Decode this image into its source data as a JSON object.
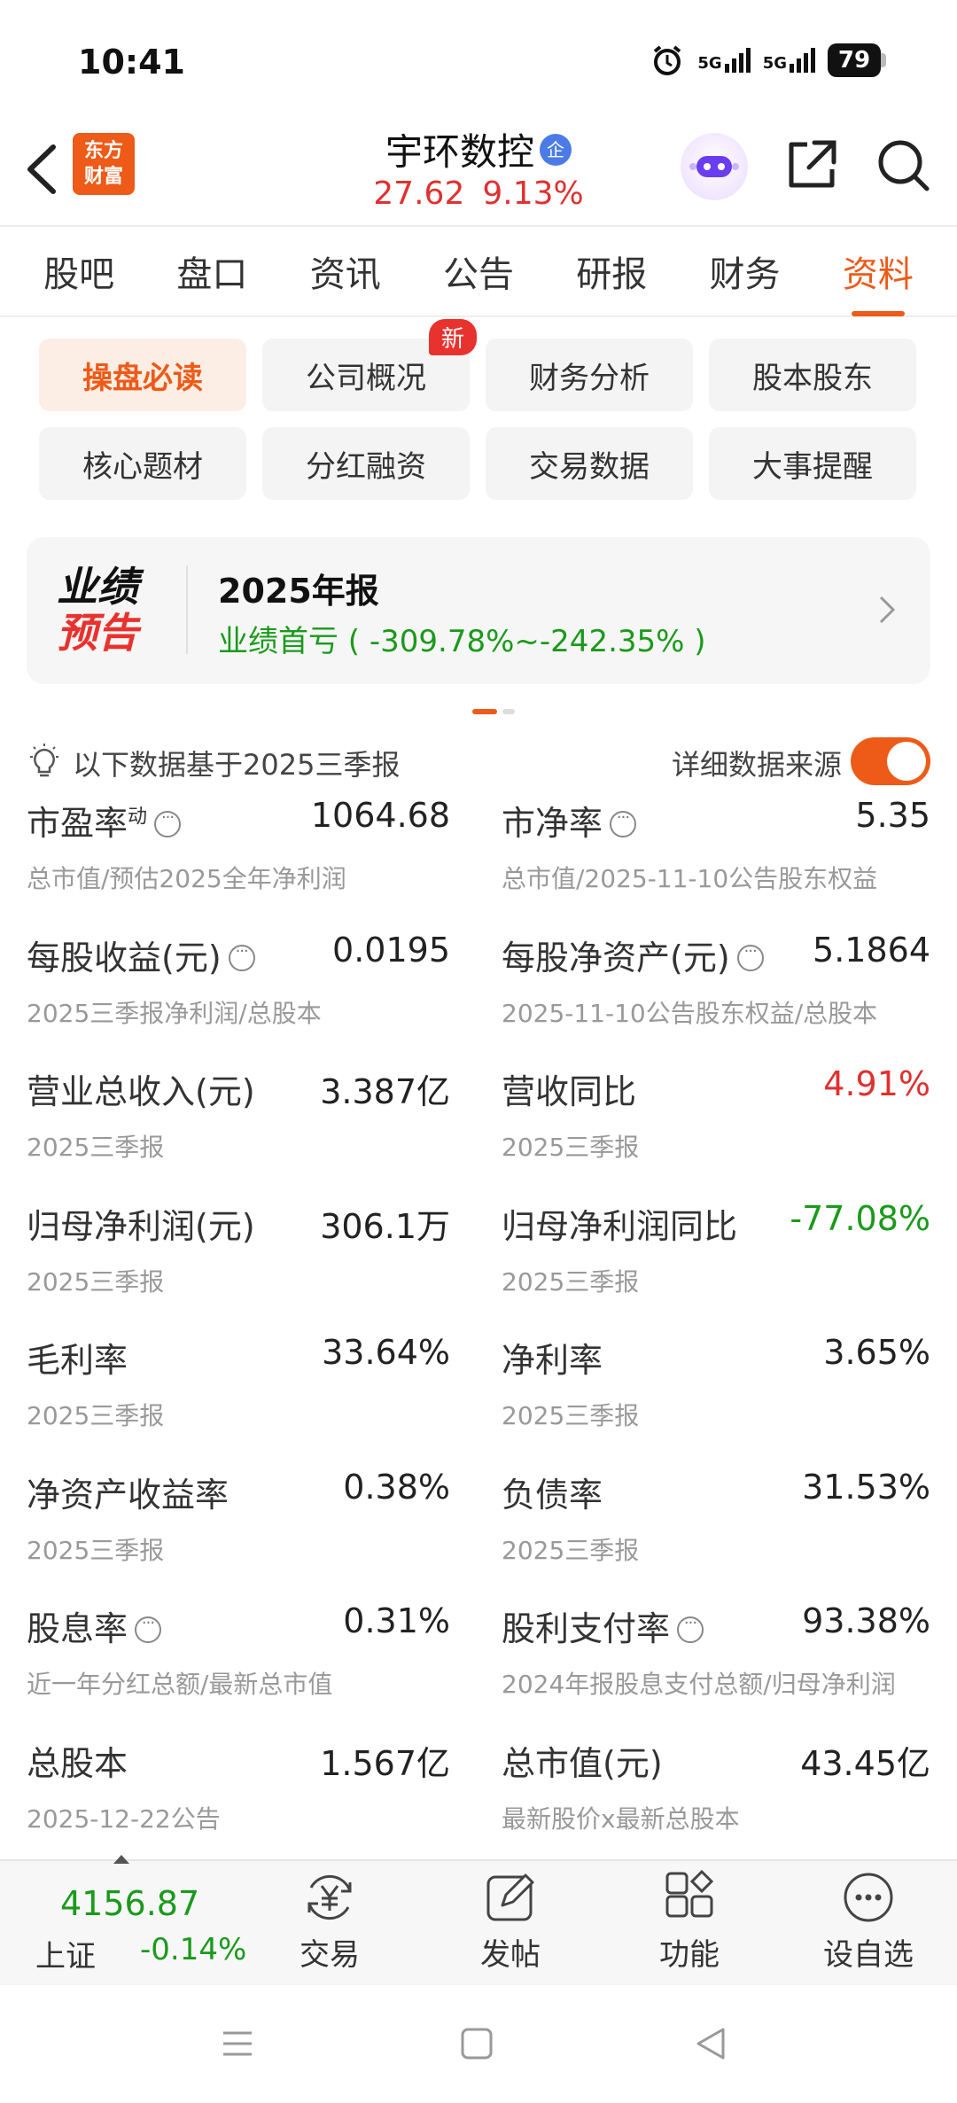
{
  "status_bar": {
    "time": "10:41",
    "net1": "5G",
    "net2": "5G",
    "battery": "79"
  },
  "header": {
    "logo_line1": "东方",
    "logo_line2": "财富",
    "stock_name": "宇环数控",
    "badge": "企",
    "price": "27.62",
    "change_pct": "9.13%"
  },
  "tabs": [
    {
      "label": "股吧"
    },
    {
      "label": "盘口"
    },
    {
      "label": "资讯"
    },
    {
      "label": "公告"
    },
    {
      "label": "研报"
    },
    {
      "label": "财务"
    },
    {
      "label": "资料",
      "active": true
    }
  ],
  "chips": [
    {
      "label": "操盘必读",
      "active": true
    },
    {
      "label": "公司概况",
      "badge": "新"
    },
    {
      "label": "财务分析"
    },
    {
      "label": "股本股东"
    },
    {
      "label": "核心题材"
    },
    {
      "label": "分红融资"
    },
    {
      "label": "交易数据"
    },
    {
      "label": "大事提醒"
    }
  ],
  "forecast": {
    "logo_line1": "业绩",
    "logo_line2": "预告",
    "title": "2025年报",
    "text": "业绩首亏 ( -309.78%~-242.35% )"
  },
  "basis": {
    "text": "以下数据基于2025三季报",
    "source_label": "详细数据来源",
    "source_on": true
  },
  "metrics": [
    {
      "name": "市盈率",
      "sup": "动",
      "info": true,
      "value": "1064.68",
      "sub": "总市值/预估2025全年净利润"
    },
    {
      "name": "市净率",
      "info": true,
      "value": "5.35",
      "sub": "总市值/2025-11-10公告股东权益"
    },
    {
      "name": "每股收益(元)",
      "info": true,
      "value": "0.0195",
      "sub": "2025三季报净利润/总股本"
    },
    {
      "name": "每股净资产(元)",
      "info": true,
      "value": "5.1864",
      "sub": "2025-11-10公告股东权益/总股本"
    },
    {
      "name": "营业总收入(元)",
      "value": "3.387亿",
      "sub": "2025三季报"
    },
    {
      "name": "营收同比",
      "value": "4.91%",
      "color": "red",
      "sub": "2025三季报"
    },
    {
      "name": "归母净利润(元)",
      "value": "306.1万",
      "sub": "2025三季报"
    },
    {
      "name": "归母净利润同比",
      "value": "-77.08%",
      "color": "green",
      "sub": "2025三季报"
    },
    {
      "name": "毛利率",
      "value": "33.64%",
      "sub": "2025三季报"
    },
    {
      "name": "净利率",
      "value": "3.65%",
      "sub": "2025三季报"
    },
    {
      "name": "净资产收益率",
      "value": "0.38%",
      "sub": "2025三季报"
    },
    {
      "name": "负债率",
      "value": "31.53%",
      "sub": "2025三季报"
    },
    {
      "name": "股息率",
      "info": true,
      "value": "0.31%",
      "sub": "近一年分红总额/最新总市值"
    },
    {
      "name": "股利支付率",
      "info": true,
      "value": "93.38%",
      "sub": "2024年报股息支付总额/归母净利润"
    },
    {
      "name": "总股本",
      "value": "1.567亿",
      "sub": "2025-12-22公告"
    },
    {
      "name": "总市值(元)",
      "value": "43.45亿",
      "sub": "最新股价x最新总股本"
    }
  ],
  "bottom_bar": {
    "index_value": "4156.87",
    "index_name": "上证",
    "index_change": "-0.14%",
    "nav": [
      {
        "label": "交易",
        "icon": "trade-icon"
      },
      {
        "label": "发帖",
        "icon": "post-icon"
      },
      {
        "label": "功能",
        "icon": "apps-icon"
      },
      {
        "label": "设自选",
        "icon": "more-icon"
      }
    ]
  },
  "colors": {
    "accent": "#ee5a18",
    "up": "#e03030",
    "down": "#1a9a1a"
  }
}
